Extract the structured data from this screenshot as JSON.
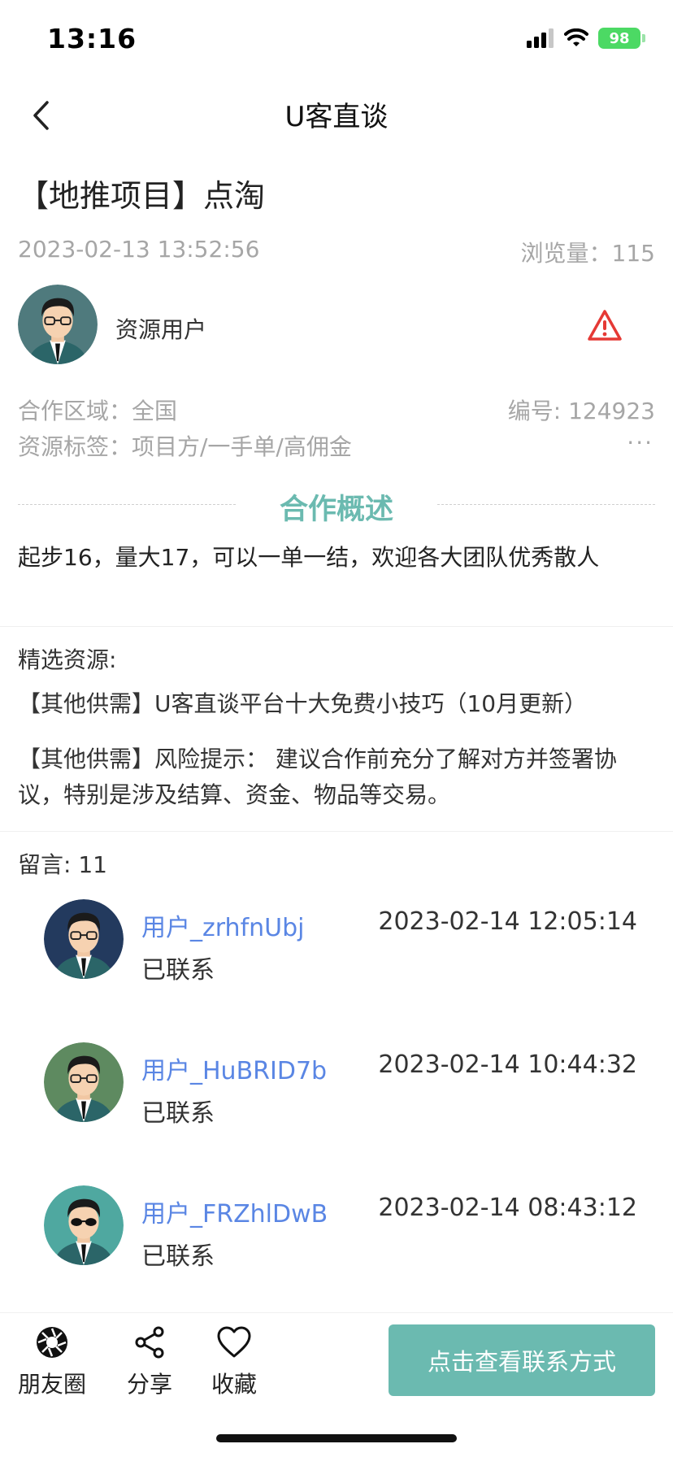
{
  "status_bar": {
    "time": "13:16",
    "battery": "98"
  },
  "nav": {
    "title": "U客直谈"
  },
  "post": {
    "title": "【地推项目】点淘",
    "date": "2023-02-13 13:52:56",
    "views": "浏览量：115",
    "author": "资源用户",
    "area": "合作区域：全国",
    "id": "编号: 124923",
    "tags": "资源标签：项目方/一手单/高佣金",
    "more": "···"
  },
  "overview": {
    "title": "合作概述",
    "text": "起步16，量大17，可以一单一结，欢迎各大团队优秀散人"
  },
  "featured": {
    "label": "精选资源:",
    "items": [
      "【其他供需】U客直谈平台十大免费小技巧（10月更新）",
      "【其他供需】风险提示： 建议合作前充分了解对方并签署协议，特别是涉及结算、资金、物品等交易。"
    ]
  },
  "comments": {
    "label": "留言: 11",
    "items": [
      {
        "user": "用户_zrhfnUbj",
        "time": "2023-02-14 12:05:14",
        "text": "已联系",
        "avatar_bg": "#233a5e"
      },
      {
        "user": "用户_HuBRID7b",
        "time": "2023-02-14 10:44:32",
        "text": "已联系",
        "avatar_bg": "#5e8a60"
      },
      {
        "user": "用户_FRZhlDwB",
        "time": "2023-02-14 08:43:12",
        "text": "已联系",
        "avatar_bg": "#4fa8a0"
      }
    ]
  },
  "bottom": {
    "moments": "朋友圈",
    "share": "分享",
    "favorite": "收藏",
    "contact": "点击查看联系方式"
  },
  "colors": {
    "accent": "#6bbab0",
    "link": "#5a86e4",
    "warning": "#e53935",
    "muted": "#a6a6a6"
  },
  "icons": [
    "back-arrow-icon",
    "signal-icon",
    "wifi-icon",
    "battery-icon",
    "warning-icon",
    "moments-icon",
    "share-icon",
    "heart-icon"
  ]
}
